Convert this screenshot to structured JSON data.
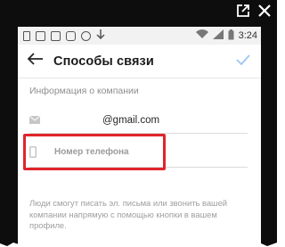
{
  "status_bar": {
    "time": "3:24",
    "battery": "100",
    "icons": [
      "sim-card-icon",
      "gallery-icon",
      "screen-icon",
      "instagram-icon",
      "notification-icon",
      "download-icon",
      "wifi-icon",
      "signal-icon",
      "battery-icon"
    ]
  },
  "header": {
    "title": "Способы связи",
    "back_icon": "arrow-left-icon",
    "done_icon": "check-icon"
  },
  "section": {
    "title": "Информация о компании"
  },
  "email": {
    "icon": "envelope-icon",
    "value": "@gmail.com"
  },
  "phone": {
    "icon": "phone-icon",
    "placeholder": "Номер телефона"
  },
  "note": "Люди смогут писать эл. письма или звонить вашей компании напрямую с помощью кнопки в вашем профиле.",
  "colors": {
    "accent": "#3897f0",
    "highlight": "#e0242b",
    "frame": "#0d0d0d"
  }
}
